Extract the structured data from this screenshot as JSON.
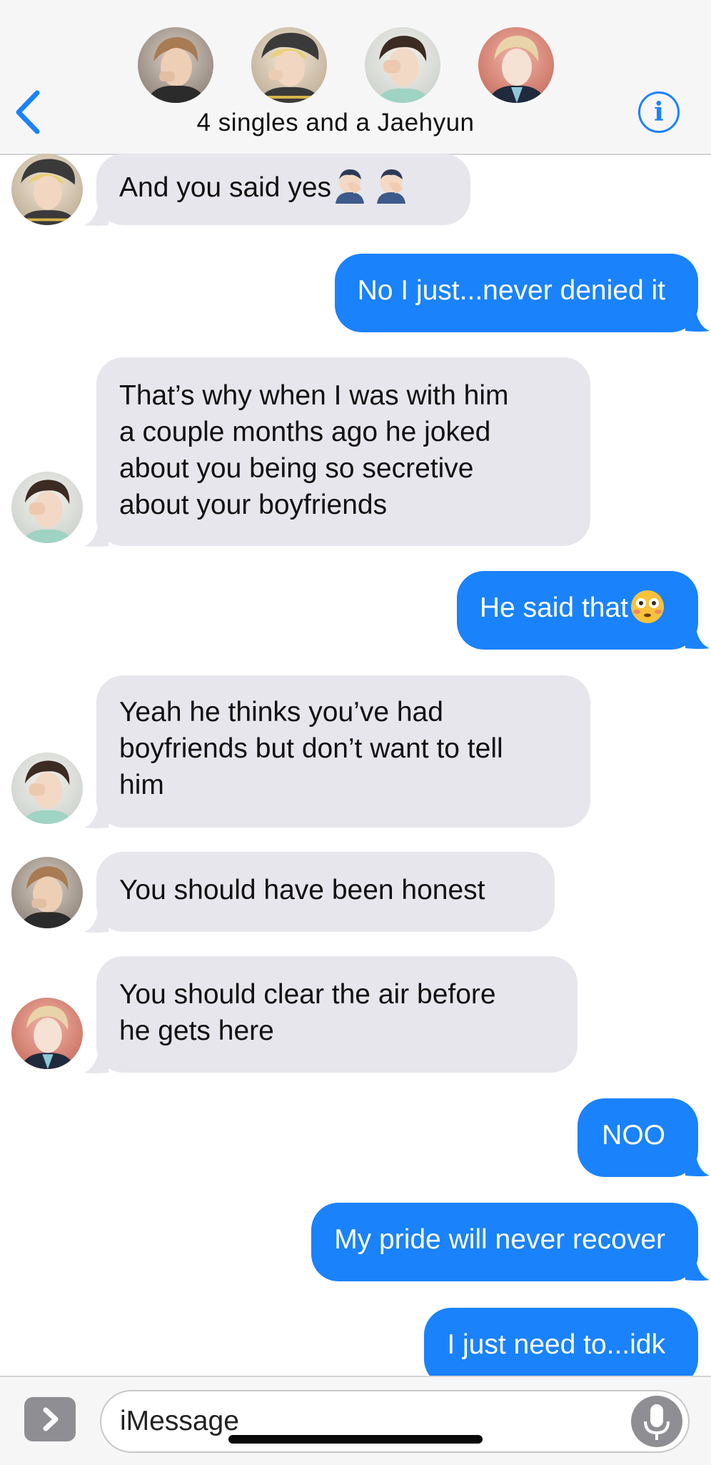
{
  "header": {
    "back_icon": "chevron-left-icon",
    "group_name": "4 singles and a Jaehyun",
    "info_icon": "info-icon",
    "info_glyph": "i",
    "accent_color": "#1a82fb"
  },
  "messages": [
    {
      "direction": "incoming",
      "text": "And you said yes",
      "emoji": "facepalm x2"
    },
    {
      "direction": "outgoing",
      "text": "No I just...never denied it"
    },
    {
      "direction": "incoming",
      "lines": [
        "That’s why when I was with him",
        "a couple months ago he joked",
        "about you being so secretive",
        "about your boyfriends"
      ]
    },
    {
      "direction": "outgoing",
      "text": "He said that",
      "emoji": "flushed-face"
    },
    {
      "direction": "incoming",
      "lines": [
        "Yeah he thinks you’ve had",
        "boyfriends but don’t want to tell",
        "him"
      ]
    },
    {
      "direction": "incoming",
      "text": "You should have been honest"
    },
    {
      "direction": "incoming",
      "lines": [
        "You should clear the air before",
        "he gets here"
      ]
    },
    {
      "direction": "outgoing",
      "text": "NOO"
    },
    {
      "direction": "outgoing",
      "text": "My pride will never recover"
    },
    {
      "direction": "outgoing",
      "text": "I just need to...idk"
    }
  ],
  "composer": {
    "placeholder": "iMessage",
    "apps_icon": "chevron-right-icon",
    "mic_icon": "microphone-icon"
  },
  "colors": {
    "outgoing_bubble": "#1a82fb",
    "incoming_bubble": "#e6e6ec",
    "bar_background": "#f6f6f7"
  }
}
